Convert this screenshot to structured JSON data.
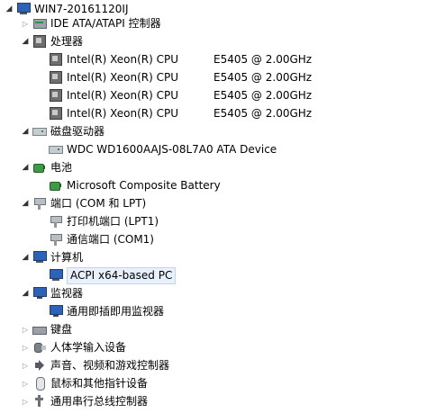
{
  "root": {
    "label": "WIN7-20161120IJ"
  },
  "tree": [
    {
      "id": "ide",
      "label": "IDE ATA/ATAPI 控制器",
      "state": "closed",
      "icon": "ide-controller-icon"
    },
    {
      "id": "cpu",
      "label": "处理器",
      "state": "open",
      "icon": "processor-icon",
      "children": [
        {
          "name": "Intel(R) Xeon(R) CPU",
          "model": "E5405  @ 2.00GHz"
        },
        {
          "name": "Intel(R) Xeon(R) CPU",
          "model": "E5405  @ 2.00GHz"
        },
        {
          "name": "Intel(R) Xeon(R) CPU",
          "model": "E5405  @ 2.00GHz"
        },
        {
          "name": "Intel(R) Xeon(R) CPU",
          "model": "E5405  @ 2.00GHz"
        }
      ]
    },
    {
      "id": "disk",
      "label": "磁盘驱动器",
      "state": "open",
      "icon": "disk-drive-icon",
      "children": [
        {
          "label": "WDC WD1600AAJS-08L7A0 ATA Device"
        }
      ]
    },
    {
      "id": "battery",
      "label": "电池",
      "state": "open",
      "icon": "battery-icon",
      "children": [
        {
          "label": "Microsoft Composite Battery"
        }
      ]
    },
    {
      "id": "ports",
      "label": "端口 (COM 和 LPT)",
      "state": "open",
      "icon": "port-icon",
      "children": [
        {
          "label": "打印机端口 (LPT1)"
        },
        {
          "label": "通信端口 (COM1)"
        }
      ]
    },
    {
      "id": "computer",
      "label": "计算机",
      "state": "open",
      "icon": "computer-icon",
      "children": [
        {
          "label": "ACPI x64-based PC",
          "selected": true
        }
      ]
    },
    {
      "id": "monitors",
      "label": "监视器",
      "state": "open",
      "icon": "monitor-icon",
      "children": [
        {
          "label": "通用即插即用监视器"
        }
      ]
    },
    {
      "id": "keyboard",
      "label": "键盘",
      "state": "closed",
      "icon": "keyboard-icon"
    },
    {
      "id": "hid",
      "label": "人体学输入设备",
      "state": "closed",
      "icon": "hid-icon"
    },
    {
      "id": "sound",
      "label": "声音、视频和游戏控制器",
      "state": "closed",
      "icon": "sound-icon"
    },
    {
      "id": "mouse",
      "label": "鼠标和其他指针设备",
      "state": "closed",
      "icon": "mouse-icon"
    },
    {
      "id": "usb",
      "label": "通用串行总线控制器",
      "state": "closed",
      "icon": "usb-icon"
    }
  ],
  "colors": {
    "selection_bg": "#e8f1fb",
    "selection_border": "#bfd6f0"
  }
}
